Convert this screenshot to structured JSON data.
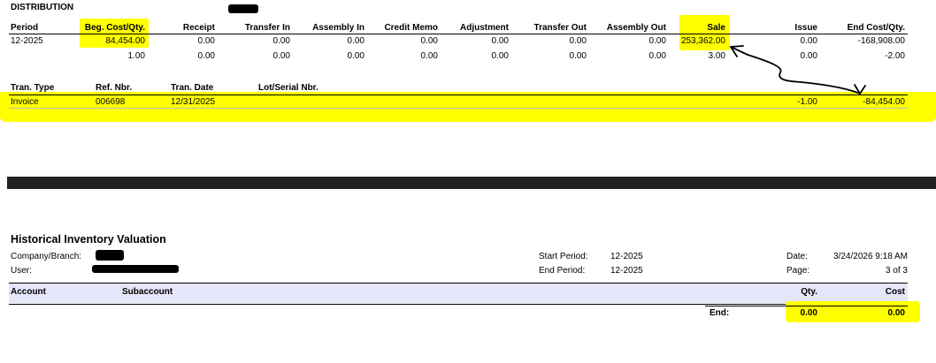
{
  "distribution": {
    "title": "DISTRIBUTION",
    "columns": [
      "Period",
      "Beg. Cost/Qty.",
      "Receipt",
      "Transfer In",
      "Assembly In",
      "Credit Memo",
      "Adjustment",
      "Transfer Out",
      "Assembly Out",
      "Sale",
      "Issue",
      "End Cost/Qty."
    ],
    "row1": [
      "12-2025",
      "84,454.00",
      "0.00",
      "0.00",
      "0.00",
      "0.00",
      "0.00",
      "0.00",
      "0.00",
      "253,362.00",
      "0.00",
      "-168,908.00"
    ],
    "row2": [
      "",
      "1.00",
      "0.00",
      "0.00",
      "0.00",
      "0.00",
      "0.00",
      "0.00",
      "0.00",
      "3.00",
      "0.00",
      "-2.00"
    ],
    "tran_columns": [
      "Tran. Type",
      "Ref. Nbr.",
      "Tran. Date",
      "Lot/Serial Nbr."
    ],
    "tran_row": {
      "type": "Invoice",
      "ref": "006698",
      "date": "12/31/2025",
      "qty": "-1.00",
      "cost": "-84,454.00"
    }
  },
  "valuation": {
    "title": "Historical Inventory Valuation",
    "company_label": "Company/Branch:",
    "user_label": "User:",
    "start_label": "Start Period:",
    "start_value": "12-2025",
    "end_label": "End Period:",
    "end_value": "12-2025",
    "date_label": "Date:",
    "date_value": "3/24/2026 9:18 AM",
    "page_label": "Page:",
    "page_value": "3 of 3",
    "columns": {
      "account": "Account",
      "subaccount": "Subaccount",
      "qty": "Qty.",
      "cost": "Cost"
    },
    "end_row": {
      "label": "End:",
      "qty": "0.00",
      "cost": "0.00"
    }
  },
  "colors": {
    "highlight": "#ffff00",
    "header_band": "#e6e6fa",
    "divider": "#222222"
  }
}
